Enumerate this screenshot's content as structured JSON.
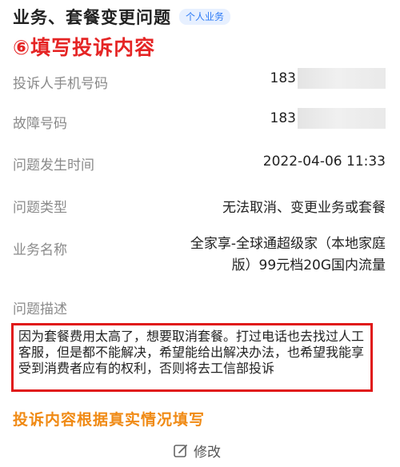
{
  "header": {
    "title": "业务、套餐变更问题",
    "tag": "个人业务"
  },
  "step_heading": "⑥填写投诉内容",
  "fields": {
    "phone": {
      "label": "投诉人手机号码",
      "value": "183"
    },
    "fault_no": {
      "label": "故障号码",
      "value": "183"
    },
    "time": {
      "label": "问题发生时间",
      "value": "2022-04-06 11:33"
    },
    "type": {
      "label": "问题类型",
      "value": "无法取消、变更业务或套餐"
    },
    "business": {
      "label": "业务名称",
      "value_line1": "全家享-全球通超级家（本地家庭",
      "value_line2": "版）99元档20G国内流量"
    },
    "description": {
      "label": "问题描述",
      "value": "因为套餐费用太高了，想要取消套餐。打过电话也去找过人工客服，但是都不能解决，希望能给出解决办法，也希望我能享受到消费者应有的权利，否则将去工信部投诉"
    }
  },
  "tip": "投诉内容根据真实情况填写",
  "edit_button": {
    "label": "修改",
    "icon": "edit-icon"
  },
  "colors": {
    "accent_red": "#e01818",
    "tip_orange": "#f08a14",
    "tag_blue": "#2f7cf6"
  }
}
